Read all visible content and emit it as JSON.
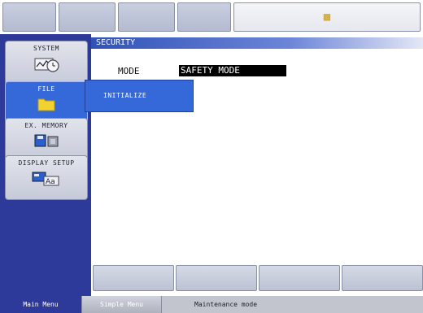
{
  "topbar": {
    "icon": "network-status-icon"
  },
  "sidebar": {
    "items": [
      {
        "label": "SYSTEM",
        "icon": "gauge-clock-icon"
      },
      {
        "label": "FILE",
        "icon": "folder-icon",
        "active": true
      },
      {
        "label": "EX. MEMORY",
        "icon": "disk-memory-icon"
      },
      {
        "label": "DISPLAY SETUP",
        "icon": "display-font-icon"
      }
    ]
  },
  "main": {
    "title": "SECURITY",
    "mode_label": "MODE",
    "mode_value": "SAFETY MODE"
  },
  "popup": {
    "items": [
      {
        "label": "INITIALIZE"
      }
    ]
  },
  "statusbar": {
    "main_menu": "Main Menu",
    "simple_menu": "Simple Menu",
    "mode_text": "Maintenance mode"
  },
  "colors": {
    "accent_blue": "#3568d9",
    "panel_blue": "#2e3a9a",
    "title_blue": "#3052b8"
  }
}
